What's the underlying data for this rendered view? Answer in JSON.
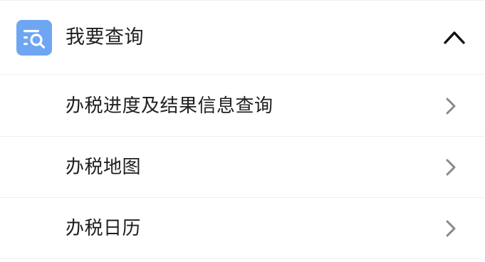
{
  "section": {
    "title": "我要查询",
    "icon": "search-list-icon",
    "expanded": true,
    "accent_color": "#6fa6f3",
    "toggle_icon": "chevron-up-icon"
  },
  "items": [
    {
      "label": "办税进度及结果信息查询",
      "icon": "chevron-right-icon"
    },
    {
      "label": "办税地图",
      "icon": "chevron-right-icon"
    },
    {
      "label": "办税日历",
      "icon": "chevron-right-icon"
    }
  ]
}
